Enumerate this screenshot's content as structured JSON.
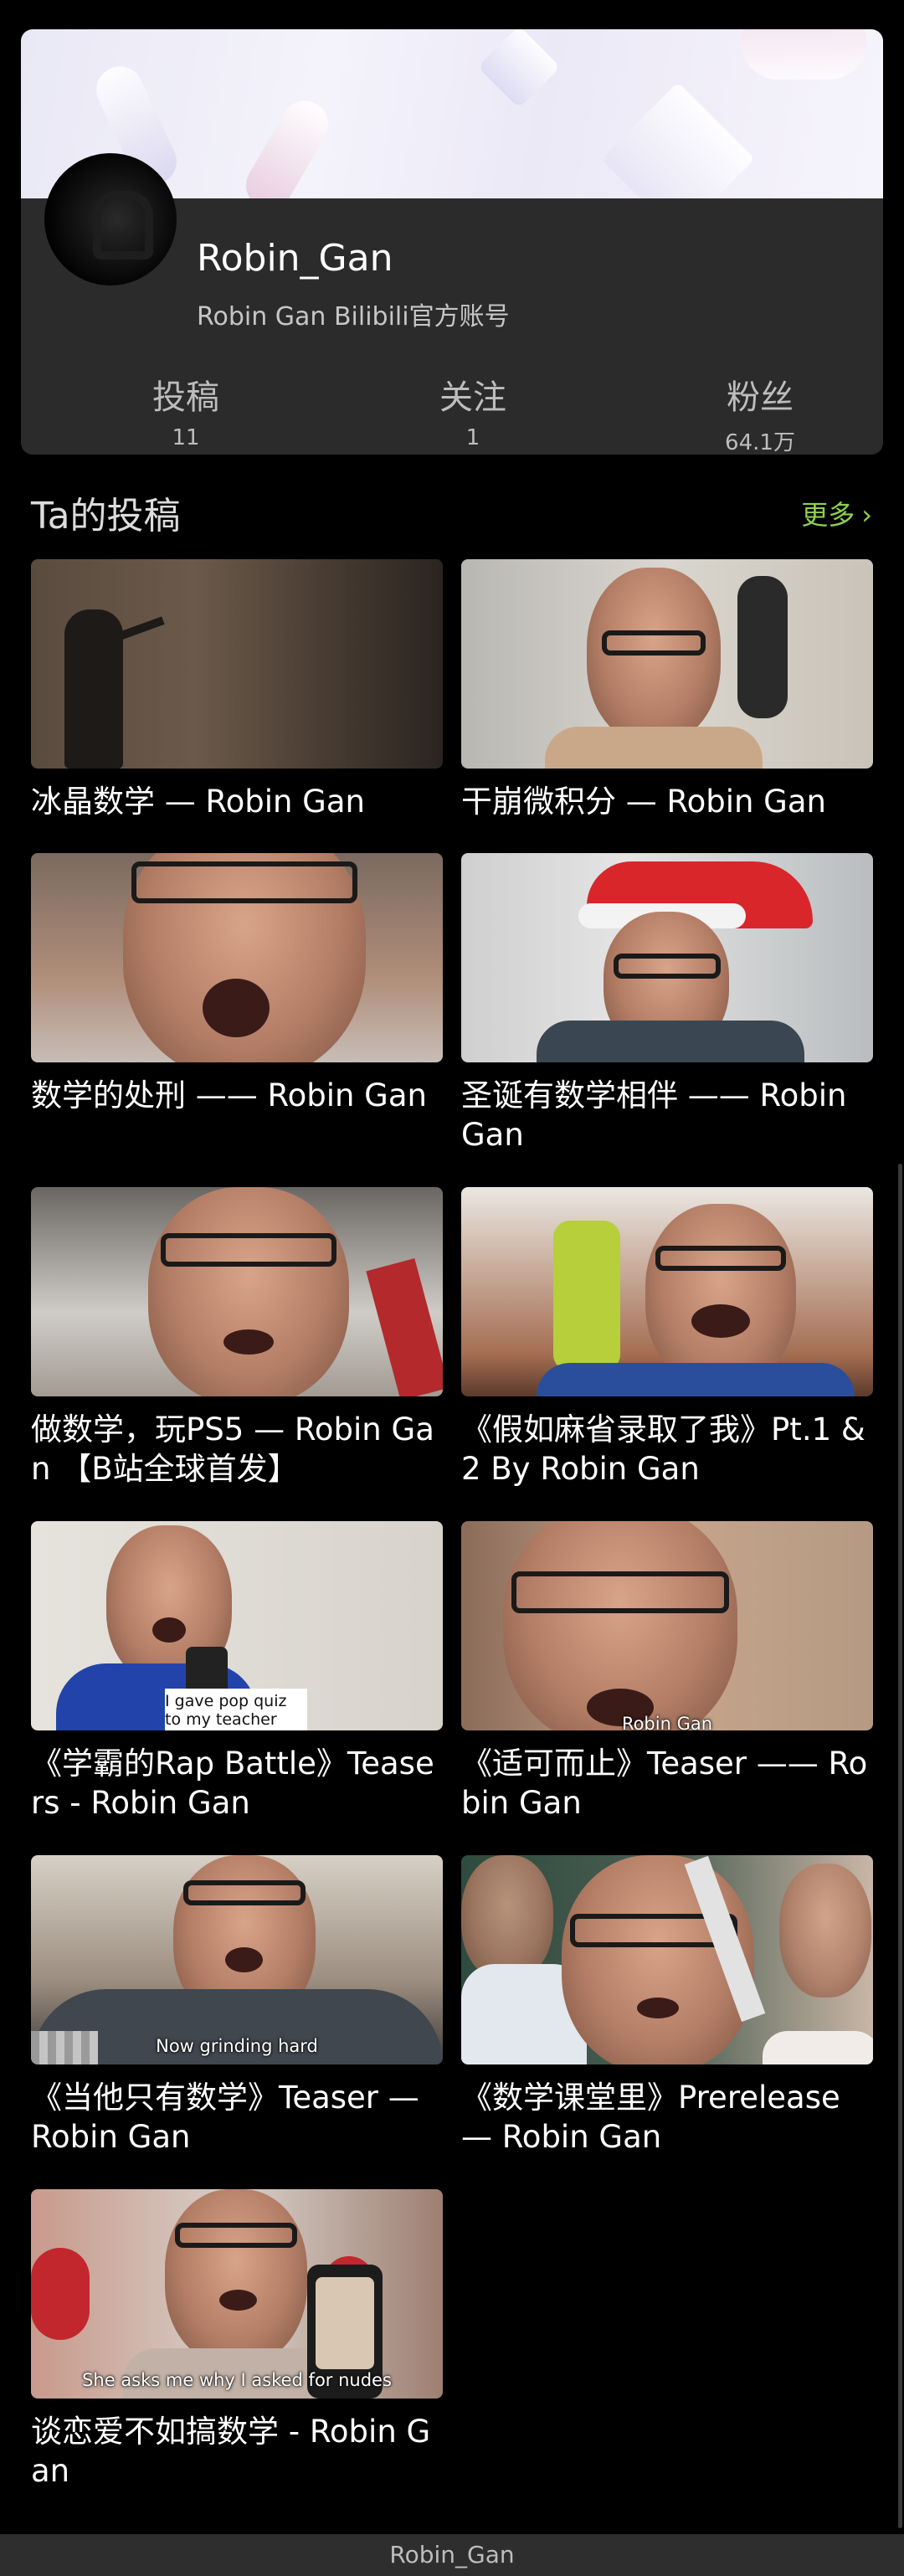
{
  "profile": {
    "name": "Robin_Gan",
    "description": "Robin Gan Bilibili官方账号",
    "stats": {
      "posts_label": "投稿",
      "posts_value": "11",
      "follow_label": "关注",
      "follow_value": "1",
      "fans_label": "粉丝",
      "fans_value": "64.1万"
    }
  },
  "section": {
    "title": "Ta的投稿",
    "more_label": "更多",
    "more_icon": "chevron-right-icon"
  },
  "videos": [
    {
      "title": "冰晶数学 — Robin Gan",
      "caption": ""
    },
    {
      "title": "干崩微积分 — Robin Gan",
      "caption": ""
    },
    {
      "title": "数学的处刑 —— Robin Gan",
      "caption": ""
    },
    {
      "title": "圣诞有数学相伴 —— Robin Gan",
      "caption": ""
    },
    {
      "title": "做数学，玩PS5 — Robin Gan 【B站全球首发】",
      "caption": ""
    },
    {
      "title": "《假如麻省录取了我》Pt.1 & 2 By Robin Gan",
      "caption": ""
    },
    {
      "title": "《学霸的Rap Battle》Teasers - Robin Gan",
      "caption": "I gave pop quiz to my teacher"
    },
    {
      "title": "《适可而止》Teaser —— Robin Gan",
      "caption": "Robin Gan"
    },
    {
      "title": "《当他只有数学》Teaser — Robin Gan",
      "caption": "Now grinding hard"
    },
    {
      "title": "《数学课堂里》Prerelease — Robin Gan",
      "caption": ""
    },
    {
      "title": "谈恋爱不如搞数学 - Robin Gan",
      "caption": "She asks me why I asked for nudes"
    }
  ],
  "bottom_bar": {
    "label": "Robin_Gan"
  },
  "colors": {
    "background": "#000000",
    "card": "#2b2b2b",
    "accent_green": "#8fd14f"
  }
}
